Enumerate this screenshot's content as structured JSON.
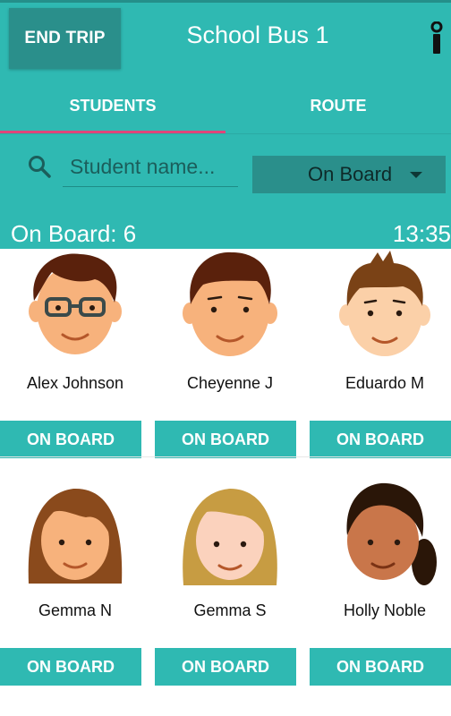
{
  "header": {
    "end_trip_label": "END TRIP",
    "title": "School Bus 1",
    "info_icon": "info-icon"
  },
  "tabs": [
    {
      "label": "STUDENTS",
      "active": true
    },
    {
      "label": "ROUTE",
      "active": false
    }
  ],
  "search": {
    "placeholder": "Student name...",
    "value": "",
    "icon": "search-icon"
  },
  "filter": {
    "selected": "On Board"
  },
  "status_bar": {
    "count_text": "On Board: 6",
    "time": "13:35"
  },
  "students": [
    {
      "name": "Alex Johnson",
      "status": "ON BOARD"
    },
    {
      "name": "Cheyenne J",
      "status": "ON BOARD"
    },
    {
      "name": "Eduardo M",
      "status": "ON BOARD"
    },
    {
      "name": "Gemma N",
      "status": "ON BOARD"
    },
    {
      "name": "Gemma S",
      "status": "ON BOARD"
    },
    {
      "name": "Holly Noble",
      "status": "ON BOARD"
    }
  ],
  "colors": {
    "primary": "#2fb9b2",
    "primary_dark": "#2a8f8b",
    "tab_indicator": "#e0457b"
  }
}
